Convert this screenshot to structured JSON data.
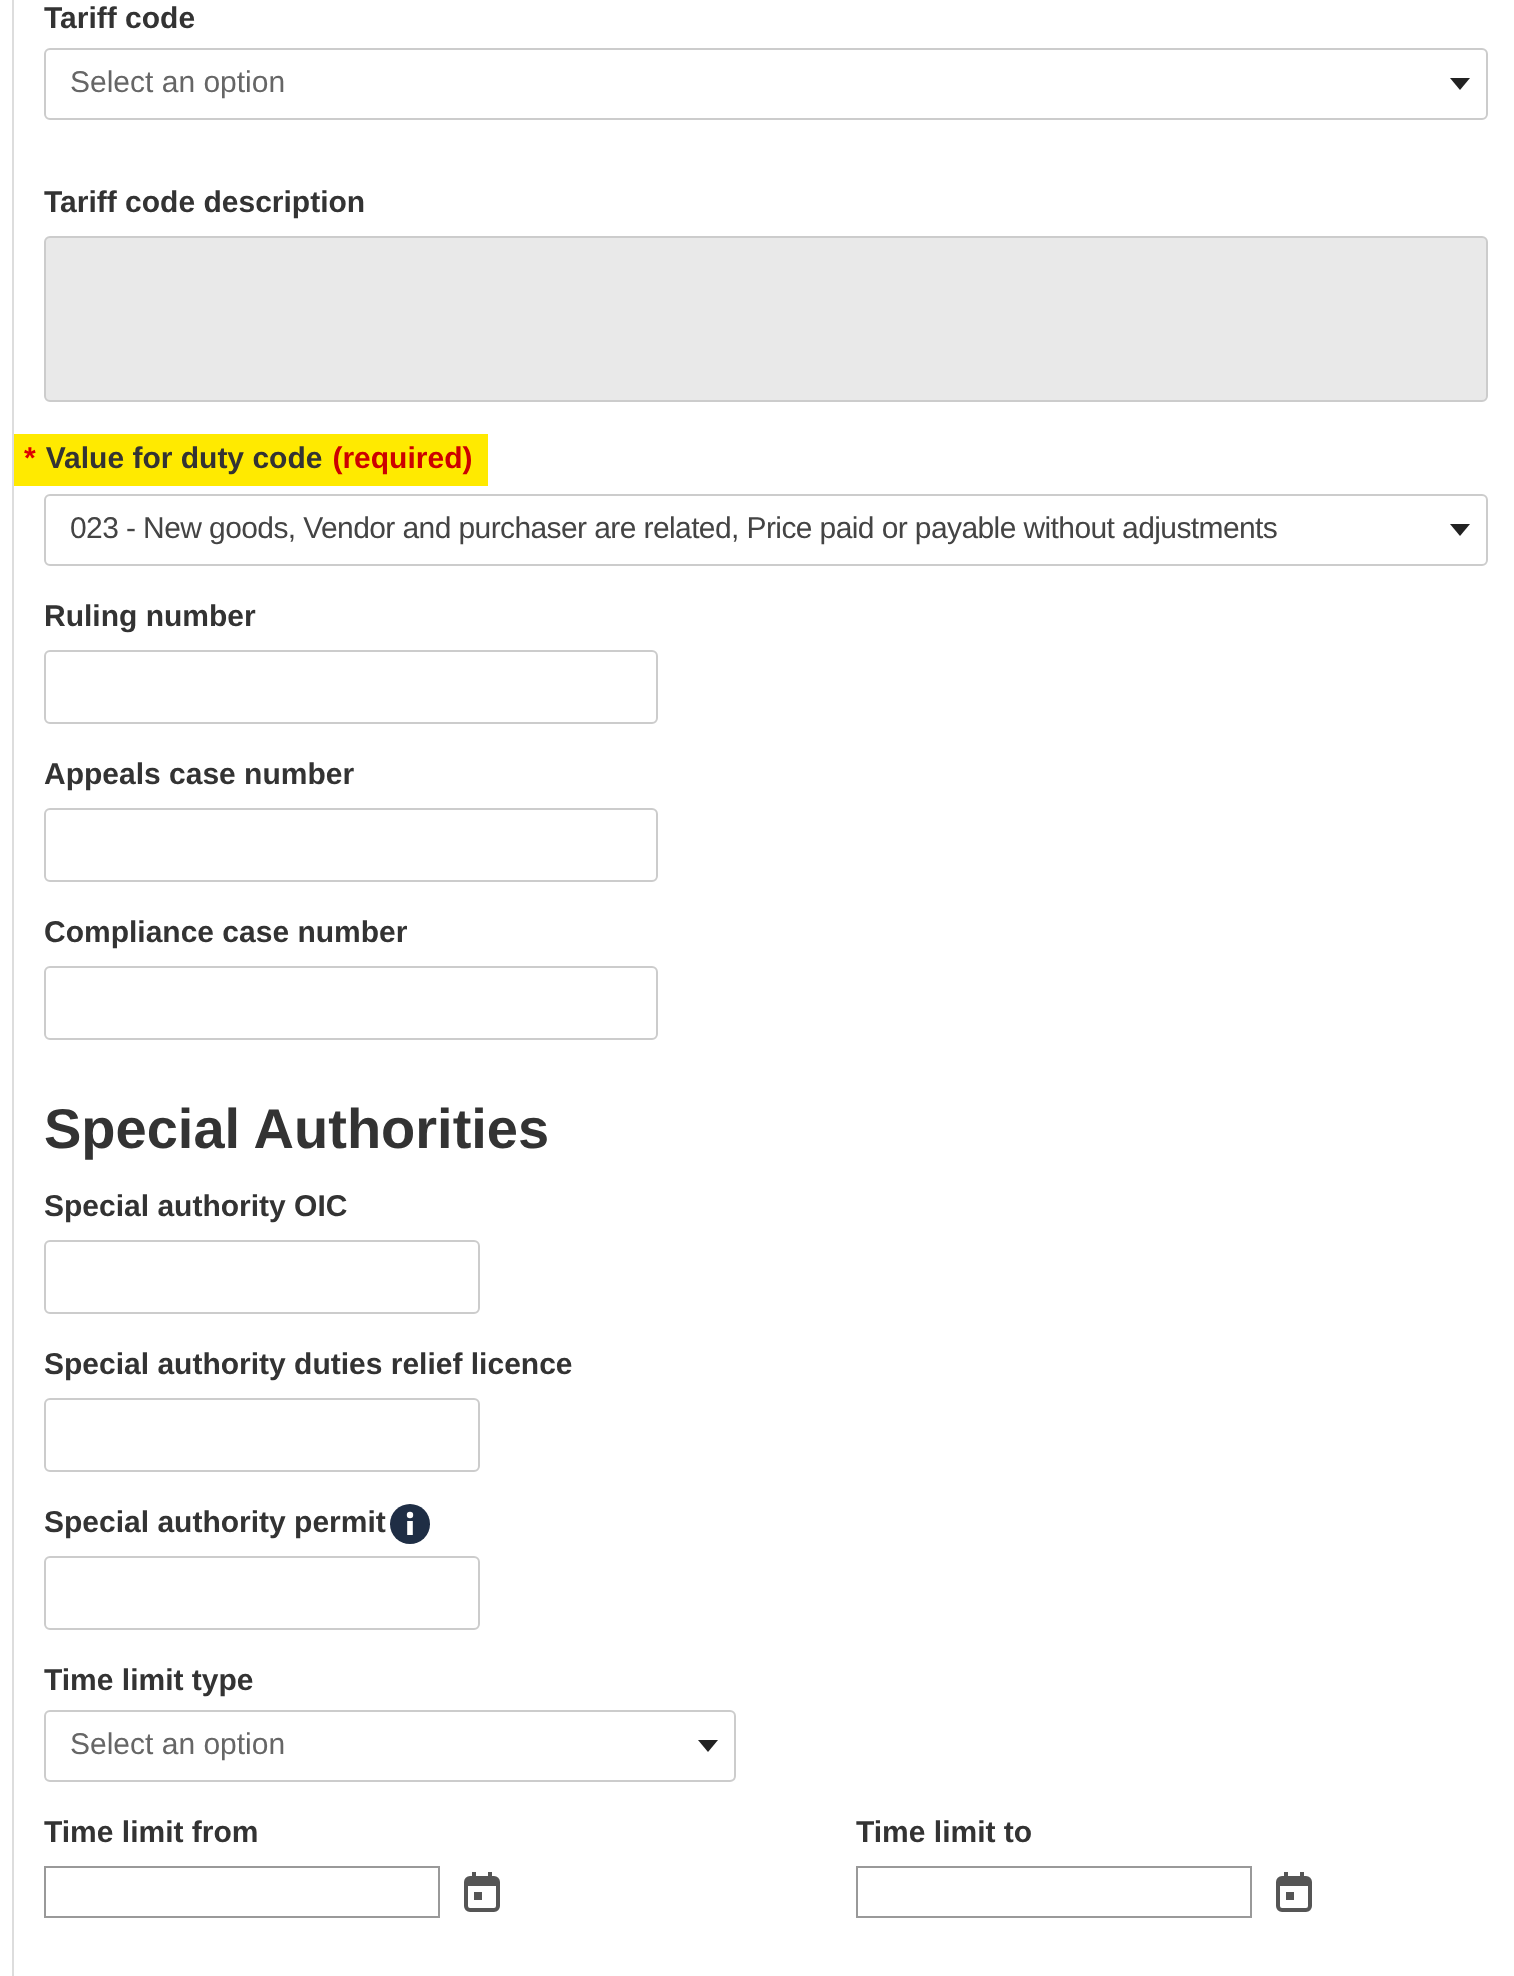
{
  "fields": [
    {
      "kind": "select",
      "label": "Tariff code",
      "placeholder": "Select an option"
    },
    {
      "kind": "textarea",
      "label": "Tariff code description",
      "disabled": true
    },
    {
      "kind": "select",
      "label": "Value for duty code",
      "required_mark": "*",
      "required_note": "(required)",
      "highlighted": true,
      "value": "023 - New goods, Vendor and purchaser are related, Price paid or payable without adjustments"
    },
    {
      "kind": "text",
      "label": "Ruling number"
    },
    {
      "kind": "text",
      "label": "Appeals case number"
    },
    {
      "kind": "text",
      "label": "Compliance case number"
    },
    {
      "kind": "heading",
      "label": "Special Authorities"
    },
    {
      "kind": "text",
      "label": "Special authority OIC"
    },
    {
      "kind": "text",
      "label": "Special authority duties relief licence"
    },
    {
      "kind": "text",
      "label": "Special authority permit",
      "info": true
    },
    {
      "kind": "select",
      "label": "Time limit type",
      "placeholder": "Select an option"
    },
    {
      "kind": "dates",
      "items": [
        {
          "label": "Time limit from"
        },
        {
          "label": "Time limit to"
        }
      ]
    }
  ]
}
